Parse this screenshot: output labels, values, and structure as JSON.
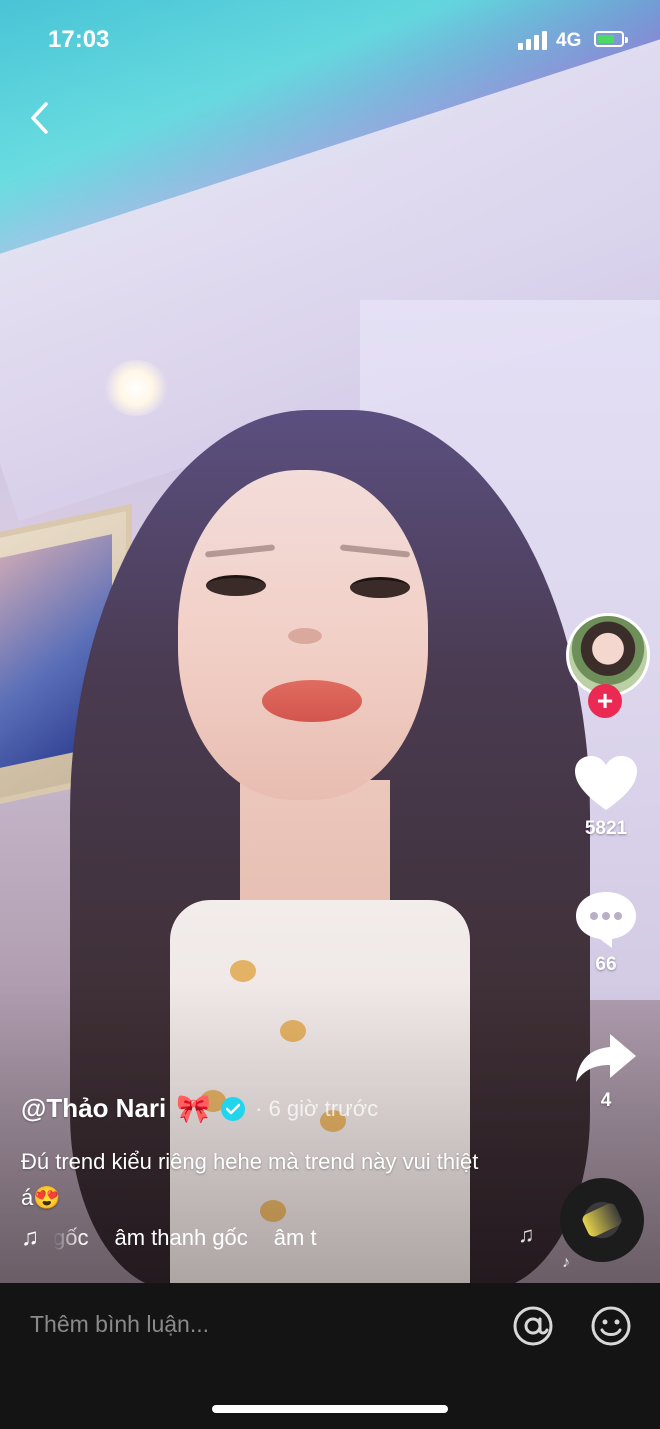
{
  "status_bar": {
    "time": "17:03",
    "network": "4G"
  },
  "author": {
    "handle": "@Thảo Nari",
    "emoji": "🎀",
    "posted": "· 6 giờ trước"
  },
  "caption": {
    "text": "Đú trend kiểu riêng hehe mà trend này vui thiệt á😍"
  },
  "music": {
    "items": [
      "gốc",
      "âm thanh gốc",
      "âm t"
    ]
  },
  "actions": {
    "likes": "5821",
    "comments": "66",
    "shares": "4"
  },
  "comment_bar": {
    "placeholder": "Thêm bình luận..."
  },
  "colors": {
    "follow": "#ea2a52",
    "verified": "#20d5ec",
    "battery": "#4cd964",
    "bottom_bar": "#141414"
  }
}
